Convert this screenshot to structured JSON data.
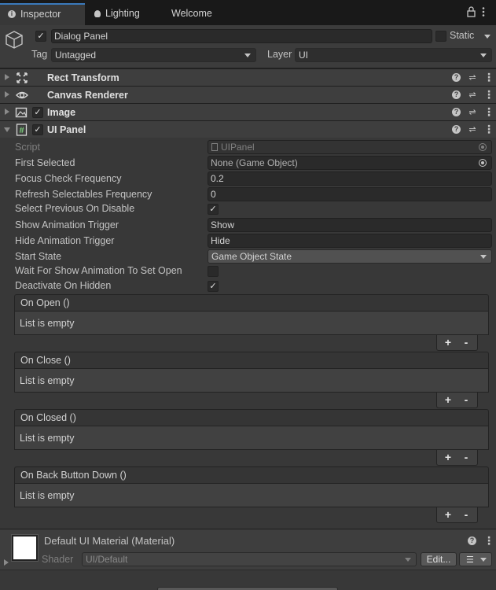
{
  "tabs": [
    {
      "label": "Inspector",
      "icon": "info-icon",
      "active": true
    },
    {
      "label": "Lighting",
      "icon": "lightbulb-icon",
      "active": false
    },
    {
      "label": "Welcome",
      "icon": "",
      "active": false
    }
  ],
  "object": {
    "name": "Dialog Panel",
    "active": true,
    "static_label": "Static",
    "tag_label": "Tag",
    "tag_value": "Untagged",
    "layer_label": "Layer",
    "layer_value": "UI"
  },
  "components": [
    {
      "title": "Rect Transform",
      "icon": "rect-transform-icon",
      "expanded": false,
      "has_toggle": false
    },
    {
      "title": "Canvas Renderer",
      "icon": "eye-icon",
      "expanded": false,
      "has_toggle": false
    },
    {
      "title": "Image",
      "icon": "image-icon",
      "expanded": false,
      "has_toggle": true
    },
    {
      "title": "UI Panel",
      "icon": "script-icon",
      "expanded": true,
      "has_toggle": true
    }
  ],
  "ui_panel": {
    "script_label": "Script",
    "script_value": "UIPanel",
    "first_selected_label": "First Selected",
    "first_selected_value": "None (Game Object)",
    "focus_check_label": "Focus Check Frequency",
    "focus_check_value": "0.2",
    "refresh_label": "Refresh Selectables Frequency",
    "refresh_value": "0",
    "select_prev_label": "Select Previous On Disable",
    "select_prev_checked": true,
    "show_anim_label": "Show Animation Trigger",
    "show_anim_value": "Show",
    "hide_anim_label": "Hide Animation Trigger",
    "hide_anim_value": "Hide",
    "start_state_label": "Start State",
    "start_state_value": "Game Object State",
    "wait_label": "Wait For Show Animation To Set Open",
    "wait_checked": false,
    "deactivate_label": "Deactivate On Hidden",
    "deactivate_checked": true
  },
  "events": [
    {
      "name": "On Open ()",
      "empty_text": "List is empty"
    },
    {
      "name": "On Close ()",
      "empty_text": "List is empty"
    },
    {
      "name": "On Closed ()",
      "empty_text": "List is empty"
    },
    {
      "name": "On Back Button Down ()",
      "empty_text": "List is empty"
    }
  ],
  "list_buttons": {
    "add": "+",
    "remove": "-"
  },
  "material": {
    "title": "Default UI Material (Material)",
    "shader_label": "Shader",
    "shader_value": "UI/Default",
    "edit_label": "Edit...",
    "swatch_color": "#ffffff"
  },
  "colors": {
    "accent": "#3a79bb",
    "background": "#383838",
    "header": "#3e3e3e"
  }
}
